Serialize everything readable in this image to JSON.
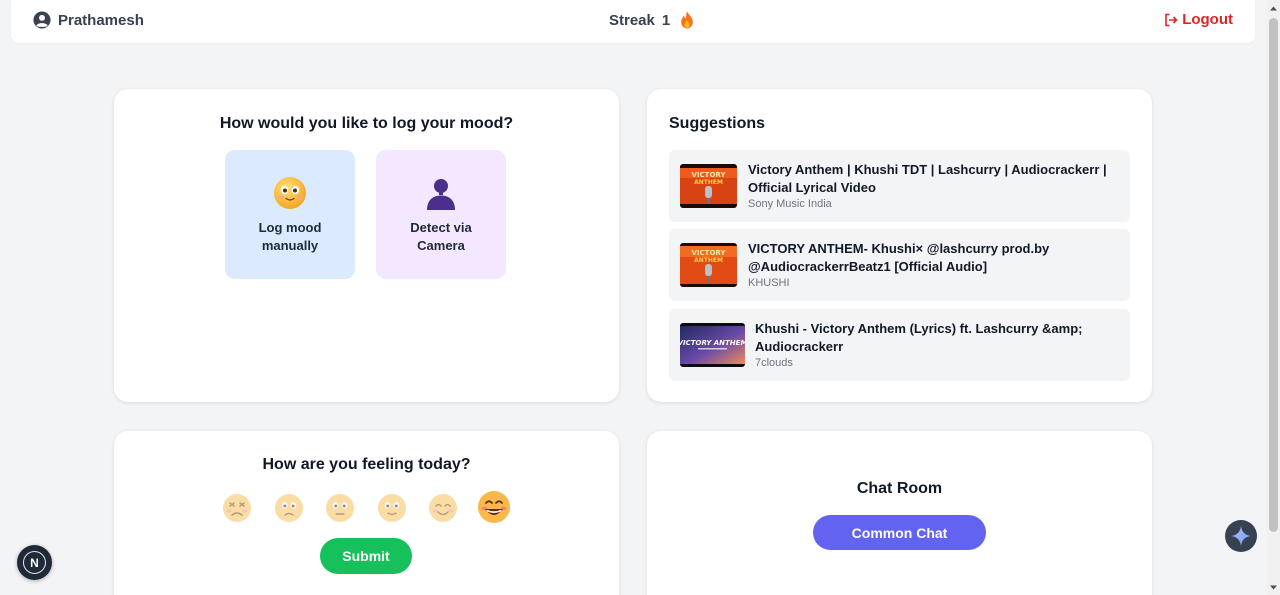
{
  "header": {
    "username": "Prathamesh",
    "streak_label": "Streak",
    "streak_count": "1",
    "logout_label": "Logout"
  },
  "mood_log": {
    "title": "How would you like to log your mood?",
    "options": [
      {
        "label": "Log mood manually",
        "icon": "smiling-face-icon"
      },
      {
        "label": "Detect via Camera",
        "icon": "person-silhouette-icon"
      }
    ]
  },
  "suggestions": {
    "title": "Suggestions",
    "items": [
      {
        "title": "Victory Anthem | Khushi TDT | Lashcurry | Audiocrackerr | Official Lyrical Video",
        "channel": "Sony Music India"
      },
      {
        "title": "VICTORY ANTHEM- Khushi× @lashcurry prod.by @AudiocrackerrBeatz1 [Official Audio]",
        "channel": "KHUSHI"
      },
      {
        "title": "Khushi - Victory Anthem (Lyrics) ft. Lashcurry &amp; Audiocrackerr",
        "channel": "7clouds"
      }
    ]
  },
  "feeling": {
    "title": "How are you feeling today?",
    "faces": [
      "very-sad-face-icon",
      "sad-face-icon",
      "neutral-face-icon",
      "slightly-happy-face-icon",
      "happy-face-icon",
      "grinning-face-icon"
    ],
    "selected_index": 5,
    "submit_label": "Submit"
  },
  "chat": {
    "title": "Chat Room",
    "button_label": "Common Chat"
  },
  "floating": {
    "next_badge": "N"
  },
  "colors": {
    "background": "#f3f4f6",
    "logout": "#dc2626",
    "submit": "#16c05a",
    "chat_button": "#6363f1",
    "manual_option": "#dbeafe",
    "camera_option": "#f3e8ff"
  }
}
